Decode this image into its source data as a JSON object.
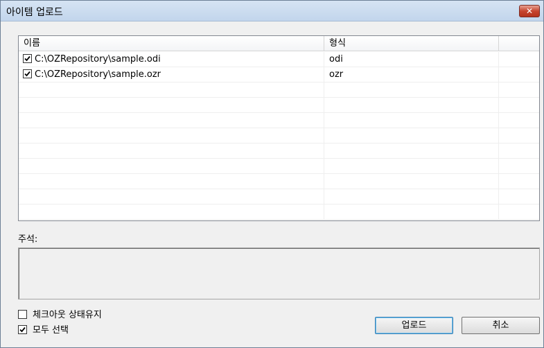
{
  "window": {
    "title": "아이템 업로드",
    "close_glyph": "✕"
  },
  "list": {
    "columns": [
      "이름",
      "형식",
      ""
    ],
    "rows": [
      {
        "checked": true,
        "name": "C:\\OZRepository\\sample.odi",
        "type": "odi"
      },
      {
        "checked": true,
        "name": "C:\\OZRepository\\sample.ozr",
        "type": "ozr"
      }
    ]
  },
  "comment": {
    "label": "주석:",
    "value": ""
  },
  "options": {
    "keep_checkout": {
      "label": "체크아웃 상태유지",
      "checked": false
    },
    "select_all": {
      "label": "모두 선택",
      "checked": true
    }
  },
  "buttons": {
    "upload": "업로드",
    "cancel": "취소"
  },
  "colors": {
    "titlebar": "#c8d9ee",
    "close_button": "#c6442f",
    "dialog_bg": "#f0f0f0"
  }
}
